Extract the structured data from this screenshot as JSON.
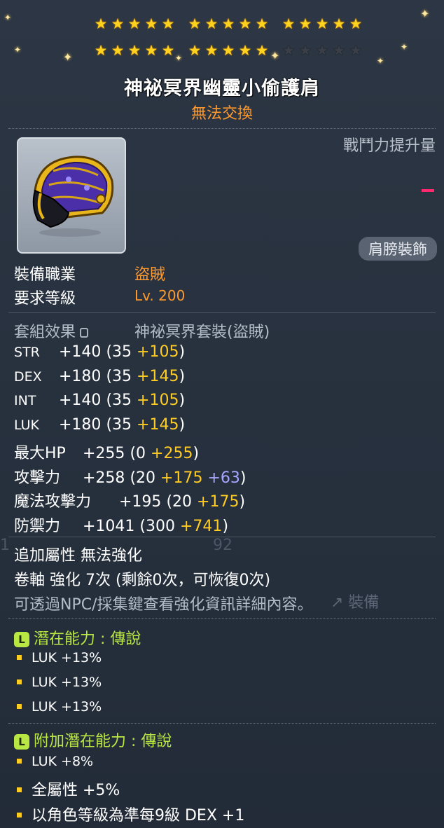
{
  "stars": {
    "row1": [
      true,
      true,
      true,
      true,
      true,
      true,
      true,
      true,
      true,
      true,
      true,
      true,
      true,
      true,
      true
    ],
    "row2": [
      true,
      true,
      true,
      true,
      true,
      true,
      true,
      true,
      true,
      true,
      false,
      false,
      false,
      false,
      false
    ]
  },
  "item": {
    "name": "神祕冥界幽靈小偷護肩",
    "trade_note": "無法交換",
    "icon": "purple-gold-shoulder-armor-icon",
    "combat_power_label": "戰鬥力提升量",
    "slot": "肩膀裝飾"
  },
  "requirements": {
    "job_label": "裝備職業",
    "job_value": "盜賊",
    "level_label": "要求等級",
    "level_value": "Lv. 200"
  },
  "set": {
    "label": "套組效果",
    "name": "神祕冥界套裝(盜賊)"
  },
  "stats": [
    {
      "name": "STR",
      "total": "+140",
      "base": "(35 ",
      "bonus": "+105",
      "extra": "",
      "close": ")"
    },
    {
      "name": "DEX",
      "total": "+180",
      "base": "(35 ",
      "bonus": "+145",
      "extra": "",
      "close": ")"
    },
    {
      "name": "INT",
      "total": "+140",
      "base": "(35 ",
      "bonus": "+105",
      "extra": "",
      "close": ")"
    },
    {
      "name": "LUK",
      "total": "+180",
      "base": "(35 ",
      "bonus": "+145",
      "extra": "",
      "close": ")"
    },
    {
      "name": "最大HP",
      "total": "+255",
      "base": "(0 ",
      "bonus": "+255",
      "extra": "",
      "close": ")"
    },
    {
      "name": "攻擊力",
      "total": "+258",
      "base": "(20 ",
      "bonus": "+175",
      "extra": " +63",
      "close": ")"
    },
    {
      "name": "魔法攻擊力",
      "total": "+195",
      "base": "(20 ",
      "bonus": "+175",
      "extra": "",
      "close": ")"
    },
    {
      "name": "防禦力",
      "total": "+1041",
      "base": "(300 ",
      "bonus": "+741",
      "extra": "",
      "close": ")"
    }
  ],
  "enhance": {
    "extra_attr": "追加屬性 無法強化",
    "scroll": "卷軸 強化 7次 (剩餘0次，可恢復0次)",
    "hint": "可透過NPC/採集鍵查看強化資訊詳細內容。"
  },
  "potential": {
    "badge": "L",
    "title": "潛在能力 : 傳說",
    "lines": [
      "LUK +13%",
      "LUK +13%",
      "LUK +13%"
    ]
  },
  "additional_potential": {
    "badge": "L",
    "title": "附加潛在能力 : 傳說",
    "lines": [
      "LUK +8%",
      "全屬性 +5%",
      "以角色等級為準每9級 DEX +1"
    ]
  },
  "background": {
    "ghost_1": "1",
    "ghost_92": "92",
    "ghost_equip": "↗ 裝備"
  },
  "colors": {
    "title": "#ffffff",
    "trade": "#ff9a2e",
    "bonus": "#ffcc22",
    "extra": "#a6a6ff",
    "potential": "#b8e642",
    "cp_dash": "#ff2a6d"
  }
}
